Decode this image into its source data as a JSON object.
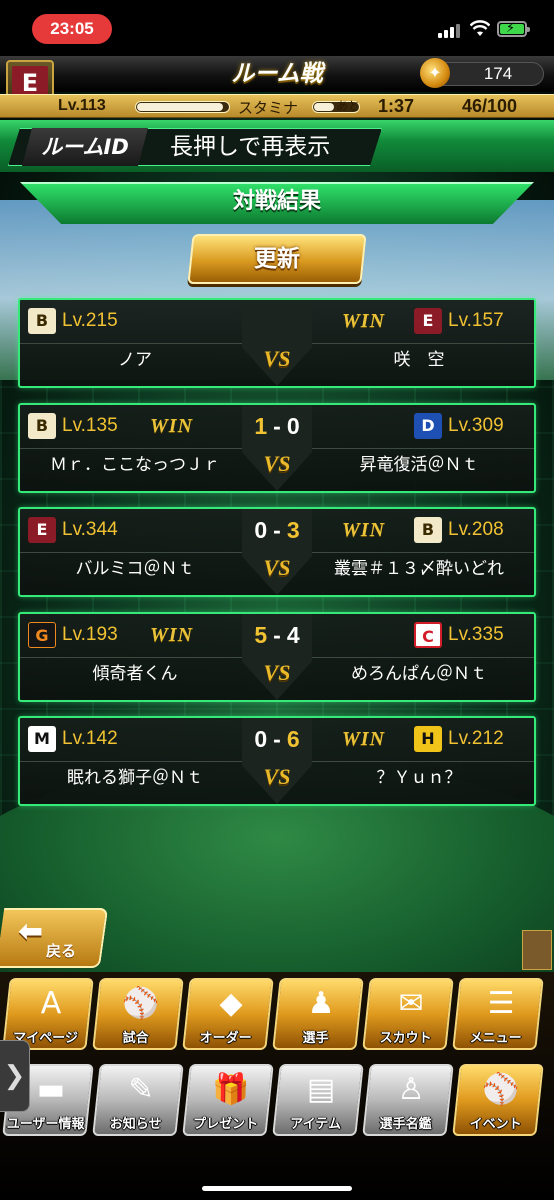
{
  "status_bar": {
    "time": "23:05"
  },
  "header": {
    "title": "ルーム戦",
    "team_badge": "E",
    "coins": "174",
    "level": "Lv.113",
    "level_progress": 0.95,
    "stamina_label": "スタミナ",
    "stamina_progress": 0.45,
    "time_left_label": "あと",
    "time_left": "1:37",
    "stamina_value": "46/100"
  },
  "room": {
    "id_label": "ルームID",
    "hint": "長押しで再表示"
  },
  "results": {
    "title": "対戦結果",
    "refresh_label": "更新",
    "vs": "VS",
    "win_label": "WIN",
    "matches": [
      {
        "left": {
          "logo": "B",
          "level": "Lv.215",
          "name": "ノア",
          "win": false
        },
        "right": {
          "logo": "E",
          "level": "Lv.157",
          "name": "咲　空",
          "win": true
        },
        "score_left": "",
        "score_right": ""
      },
      {
        "left": {
          "logo": "B",
          "level": "Lv.135",
          "name": "Ｍｒ．ここなっつＪｒ",
          "win": true
        },
        "right": {
          "logo": "D",
          "level": "Lv.309",
          "name": "昇竜復活＠Ｎｔ",
          "win": false
        },
        "score_left": "1",
        "score_right": "0"
      },
      {
        "left": {
          "logo": "E",
          "level": "Lv.344",
          "name": "バルミコ＠Ｎｔ",
          "win": false
        },
        "right": {
          "logo": "B",
          "level": "Lv.208",
          "name": "叢雲＃１３〆酔いどれ",
          "win": true
        },
        "score_left": "0",
        "score_right": "3"
      },
      {
        "left": {
          "logo": "G",
          "level": "Lv.193",
          "name": "傾奇者くん",
          "win": true
        },
        "right": {
          "logo": "C",
          "level": "Lv.335",
          "name": "めろんぱん＠Ｎｔ",
          "win": false
        },
        "score_left": "5",
        "score_right": "4"
      },
      {
        "left": {
          "logo": "M",
          "level": "Lv.142",
          "name": "眠れる獅子＠Ｎｔ",
          "win": false
        },
        "right": {
          "logo": "H",
          "level": "Lv.212",
          "name": "？Ｙｕｎ？",
          "win": true
        },
        "score_left": "0",
        "score_right": "6"
      }
    ]
  },
  "nav": {
    "back_label": "戻る"
  },
  "menu": {
    "row1": [
      {
        "label": "マイページ",
        "icon": "A"
      },
      {
        "label": "試合",
        "icon": "⚾"
      },
      {
        "label": "オーダー",
        "icon": "◆"
      },
      {
        "label": "選手",
        "icon": "♟"
      },
      {
        "label": "スカウト",
        "icon": "✉"
      },
      {
        "label": "メニュー",
        "icon": "☰"
      }
    ],
    "row2": [
      {
        "label": "ユーザー情報",
        "icon": "▬"
      },
      {
        "label": "お知らせ",
        "icon": "✎"
      },
      {
        "label": "プレゼント",
        "icon": "🎁"
      },
      {
        "label": "アイテム",
        "icon": "▤"
      },
      {
        "label": "選手名鑑",
        "icon": "♙"
      },
      {
        "label": "イベント",
        "icon": "⚾"
      }
    ]
  },
  "colors": {
    "accent_green": "#35ea78",
    "gold": "#e9c23a",
    "level_gold": "#f1c232",
    "score_gold": "#f1c232"
  }
}
